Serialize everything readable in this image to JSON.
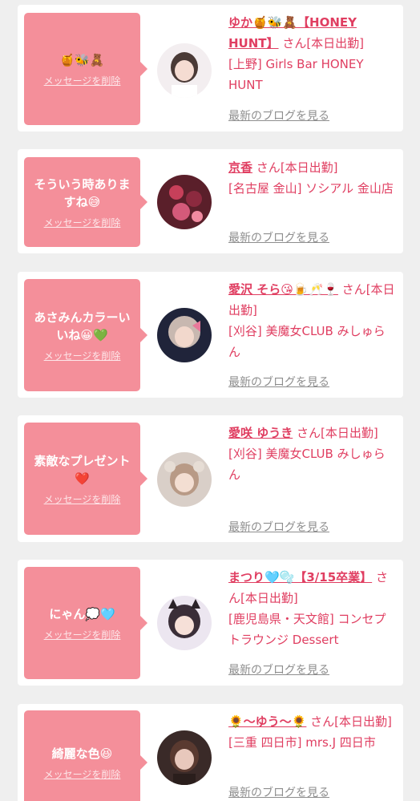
{
  "common": {
    "delete_label": "メッセージを削除",
    "blog_label": "最新のブログを見る",
    "san": "さん"
  },
  "colors": {
    "bubble": "#f48f9a",
    "accent": "#e03e61",
    "muted": "#8e8e8e",
    "background": "#efefef"
  },
  "messages": [
    {
      "message": "🍯🐝🧸",
      "name": "ゆか🍯🐝🧸【HONEY HUNT】",
      "status": "[本日出勤]",
      "shop": "[上野] Girls Bar HONEY HUNT"
    },
    {
      "message": "そういう時ありますね😅",
      "name": "京香",
      "status": "[本日出勤]",
      "shop": "[名古屋 金山] ソシアル 金山店"
    },
    {
      "message": "あさみんカラーいいね😀💚",
      "name": "愛沢 そら😘🍺🥂🍷",
      "status": "[本日出勤]",
      "shop": "[刈谷] 美魔女CLUB みしゅらん"
    },
    {
      "message": "素敵なプレゼント❤️",
      "name": "愛咲 ゆうき",
      "status": "[本日出勤]",
      "shop": "[刈谷] 美魔女CLUB みしゅらん"
    },
    {
      "message": "にゃん💭🩵",
      "name": "まつり🩵🫧【3/15卒業】",
      "status": "[本日出勤]",
      "shop": "[鹿児島県・天文館] コンセプトラウンジ Dessert"
    },
    {
      "message": "綺麗な色😆",
      "name": "🌻〜ゆう〜🌻",
      "status": "[本日出勤]",
      "shop": "[三重 四日市] mrs.J 四日市"
    }
  ]
}
